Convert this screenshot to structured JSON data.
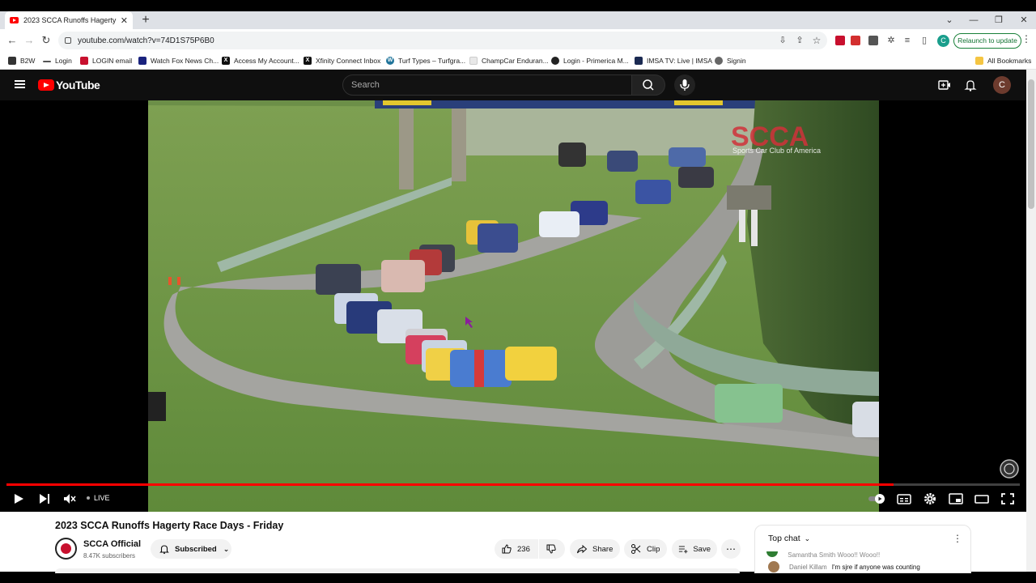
{
  "browser": {
    "tab_title": "2023 SCCA Runoffs Hagerty Race Days - Friday",
    "new_tab": "+",
    "url": "youtube.com/watch?v=74D1S75P6B0",
    "relaunch": "Relaunch to update",
    "profile_initial": "C",
    "bookmarks": [
      {
        "label": "B2W",
        "icon": "grid-icon",
        "color": "#333333"
      },
      {
        "label": "Login",
        "icon": "dash-icon",
        "color": "#555555"
      },
      {
        "label": "LOGIN email",
        "icon": "glu-icon",
        "color": "#c8102e"
      },
      {
        "label": "Watch Fox News Ch...",
        "icon": "fox-icon",
        "color": "#1a237e"
      },
      {
        "label": "Access My Account...",
        "icon": "x-icon",
        "color": "#111111"
      },
      {
        "label": "Xfinity Connect Inbox",
        "icon": "x-icon",
        "color": "#111111"
      },
      {
        "label": "Turf Types – Turfgra...",
        "icon": "wordpress-icon",
        "color": "#21759b"
      },
      {
        "label": "ChampCar Enduran...",
        "icon": "folder-icon",
        "color": "#e8e8e8"
      },
      {
        "label": "Login - Primerica M...",
        "icon": "shield-icon",
        "color": "#222222"
      },
      {
        "label": "IMSA TV: Live | IMSA",
        "icon": "imsa-icon",
        "color": "#1b2a52"
      },
      {
        "label": "Signin",
        "icon": "globe-icon",
        "color": "#666666"
      }
    ],
    "all_bookmarks": "All Bookmarks"
  },
  "youtube": {
    "logo_text": "YouTube",
    "search_placeholder": "Search",
    "avatar_initial": "C"
  },
  "player": {
    "overlay_brand": "SCCA",
    "overlay_sub": "Sports Car Club of America",
    "live_label": "LIVE",
    "progress": 0.875
  },
  "video": {
    "title": "2023 SCCA Runoffs Hagerty Race Days - Friday",
    "channel": "SCCA Official",
    "subscribers": "8.47K subscribers",
    "subscribed_label": "Subscribed",
    "likes": "236",
    "share_label": "Share",
    "clip_label": "Clip",
    "save_label": "Save"
  },
  "chat": {
    "title": "Top chat",
    "line1": "Samantha Smith  Wooo!! Wooo!!",
    "line2_author": "Daniel Killam",
    "line2_text": "I'm sjre if anyone was counting"
  }
}
